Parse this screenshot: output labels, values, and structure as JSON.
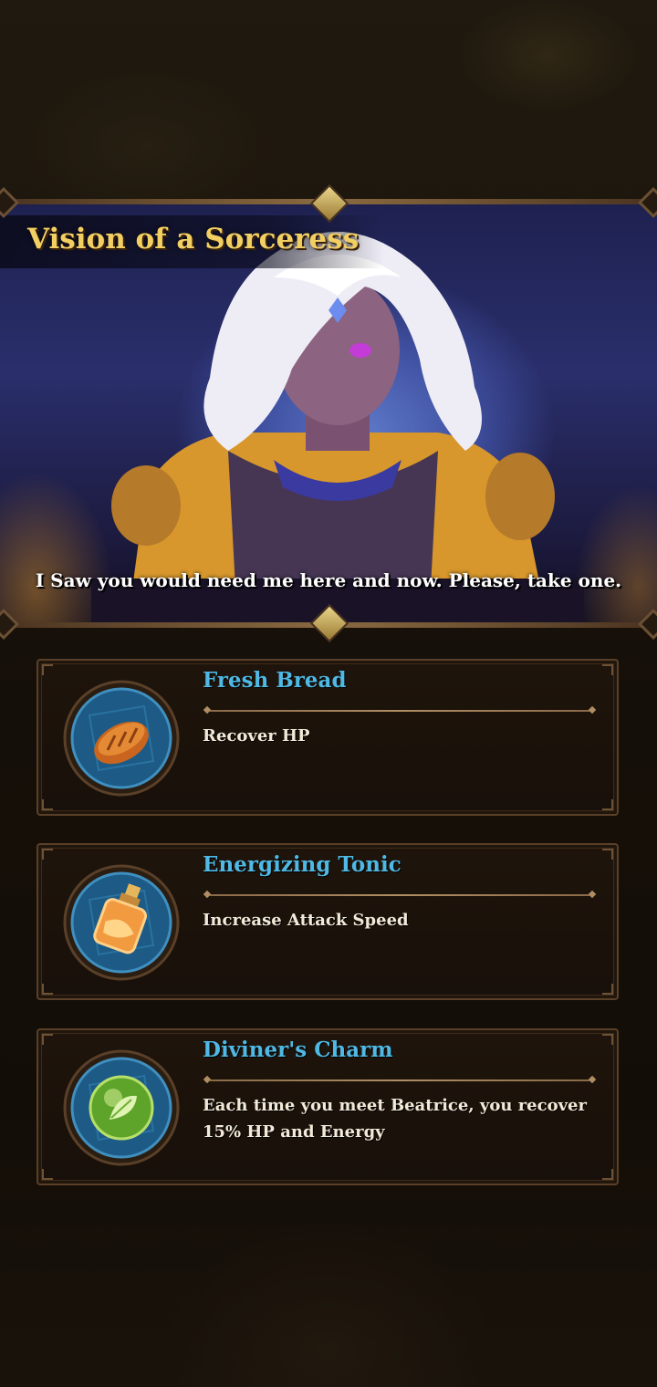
{
  "event": {
    "title": "Vision of a Sorceress",
    "dialogue": "I Saw you would need me here and now. Please, take one."
  },
  "rewards": [
    {
      "name": "Fresh Bread",
      "description": "Recover HP",
      "icon": "bread-icon"
    },
    {
      "name": "Energizing Tonic",
      "description": "Increase Attack Speed",
      "icon": "potion-icon"
    },
    {
      "name": "Diviner's Charm",
      "description": "Each time you meet Beatrice, you recover 15% HP and Energy",
      "icon": "leaf-orb-icon"
    }
  ],
  "colors": {
    "title_gold": "#f2cf63",
    "item_name_blue": "#4fb8e4",
    "card_border": "#5a4028",
    "medallion_blue": "#1f5d88"
  }
}
